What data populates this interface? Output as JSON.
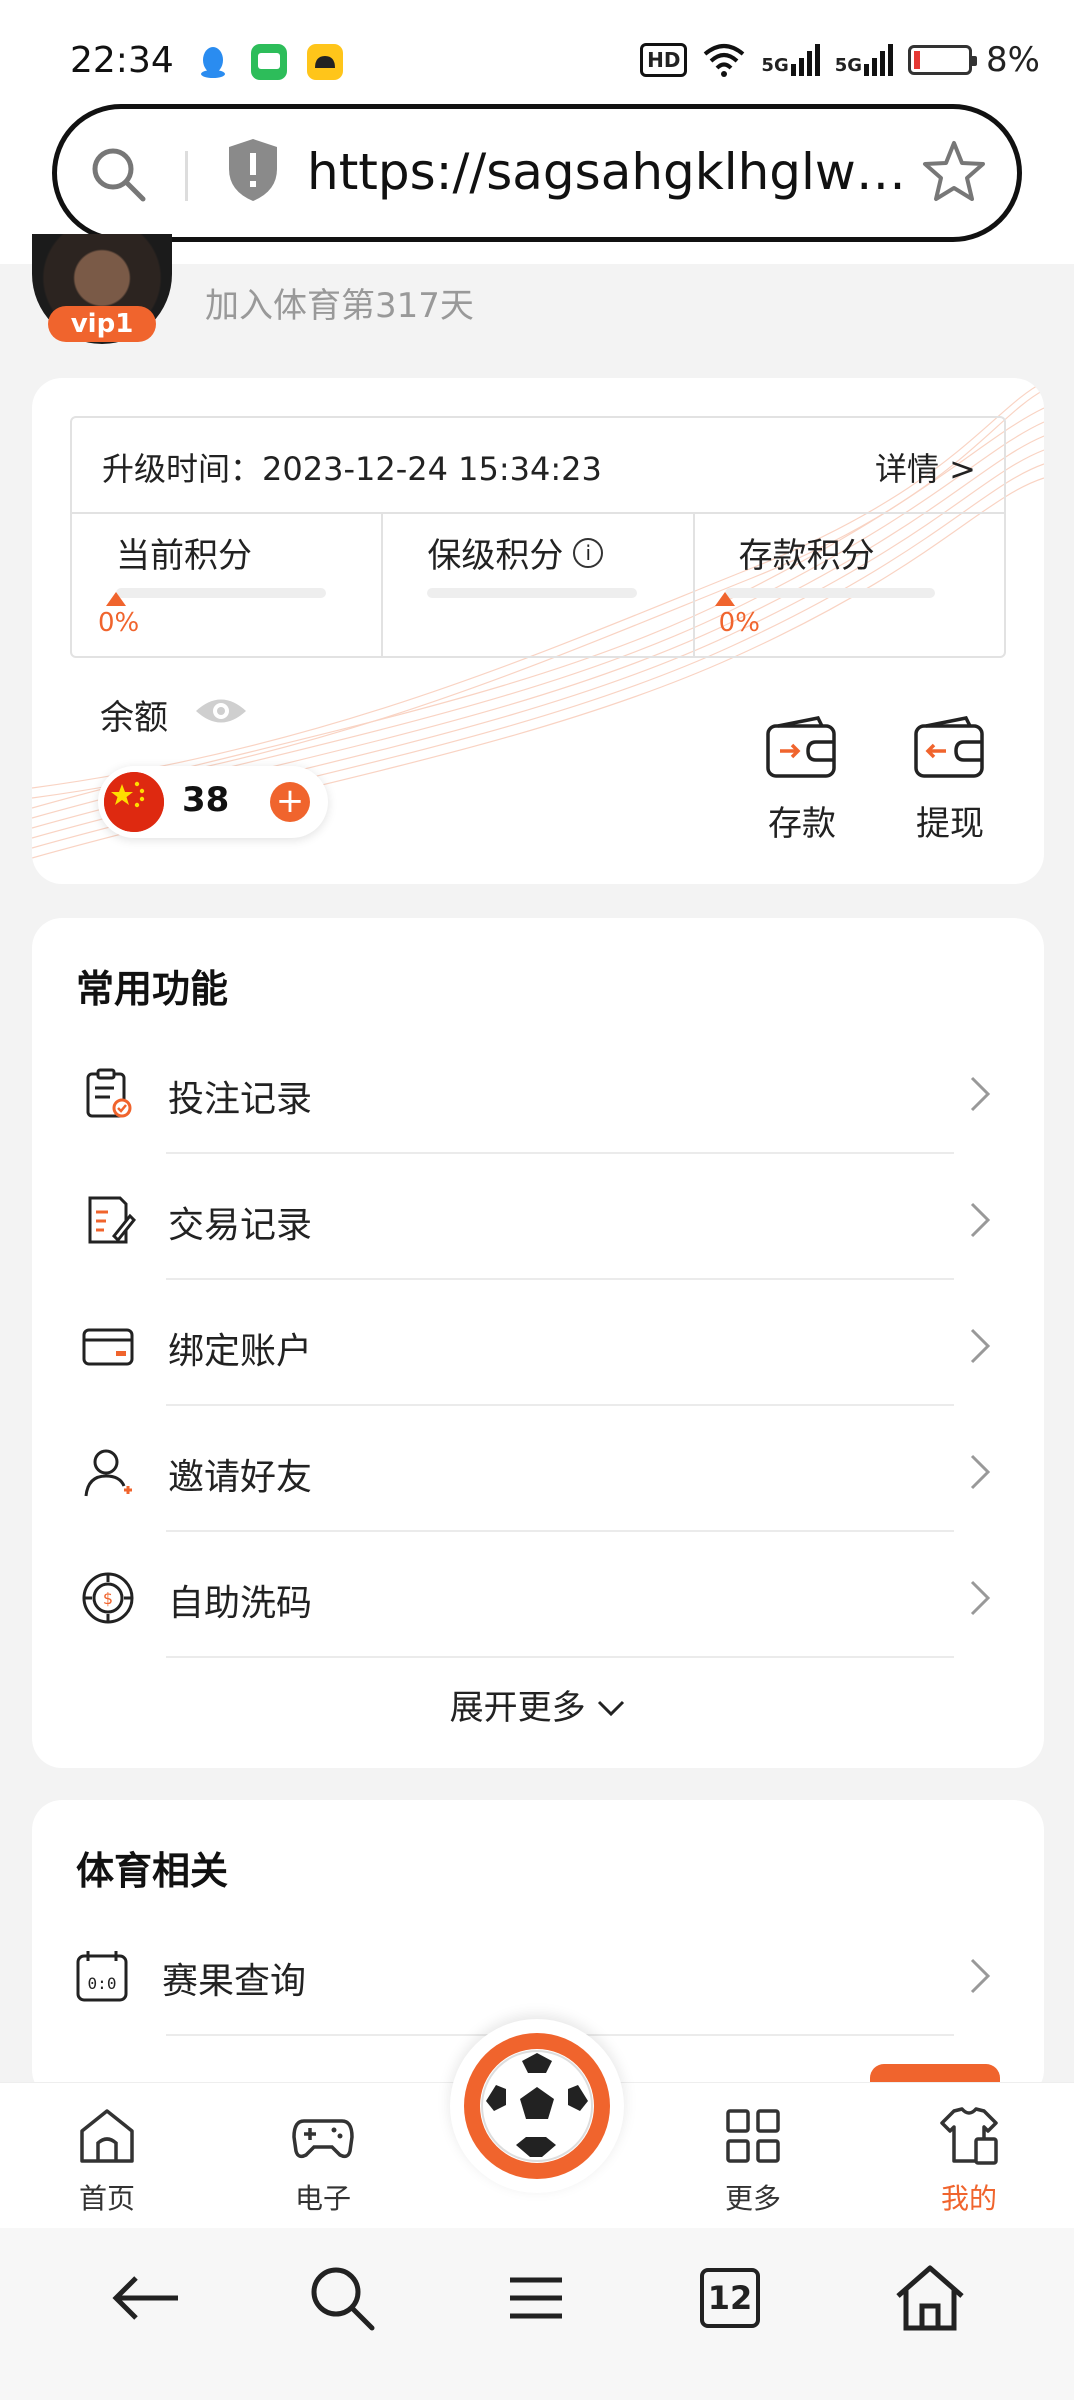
{
  "status_bar": {
    "time": "22:34",
    "hd_label": "HD",
    "net1": "5G",
    "net2": "5G",
    "battery_text": "8%",
    "battery_level": 0.08
  },
  "url_bar": {
    "url": "https://sagsahgklhglwpf..."
  },
  "profile": {
    "vip_badge": "vip1",
    "join_text": "加入体育第317天"
  },
  "upgrade": {
    "label": "升级时间：2023-12-24 15:34:23",
    "detail_link": "详情 >",
    "columns": [
      {
        "title": "当前积分",
        "percent": "0%"
      },
      {
        "title": "保级积分",
        "info": "i"
      },
      {
        "title": "存款积分",
        "percent": "0%"
      }
    ]
  },
  "balance": {
    "label": "余额",
    "amount": "38",
    "plus": "+",
    "deposit": "存款",
    "withdraw": "提现"
  },
  "common": {
    "title": "常用功能",
    "items": [
      {
        "label": "投注记录",
        "icon": "bet-record-icon"
      },
      {
        "label": "交易记录",
        "icon": "transaction-record-icon"
      },
      {
        "label": "绑定账户",
        "icon": "bind-card-icon"
      },
      {
        "label": "邀请好友",
        "icon": "invite-friend-icon"
      },
      {
        "label": "自助洗码",
        "icon": "chip-icon"
      }
    ],
    "expand": "展开更多"
  },
  "sports": {
    "title": "体育相关",
    "items": [
      {
        "label": "赛果查询",
        "icon": "calendar-score-icon"
      }
    ]
  },
  "tabbar": {
    "tabs": [
      {
        "label": "首页",
        "icon": "home-icon"
      },
      {
        "label": "电子",
        "icon": "gamepad-icon"
      },
      {
        "label": "更多",
        "icon": "grid-icon"
      },
      {
        "label": "我的",
        "icon": "shirt-icon",
        "active": true
      }
    ]
  },
  "browser_nav": {
    "tab_count": "12"
  },
  "colors": {
    "accent": "#f0642d",
    "bg": "#f3f3f3"
  }
}
